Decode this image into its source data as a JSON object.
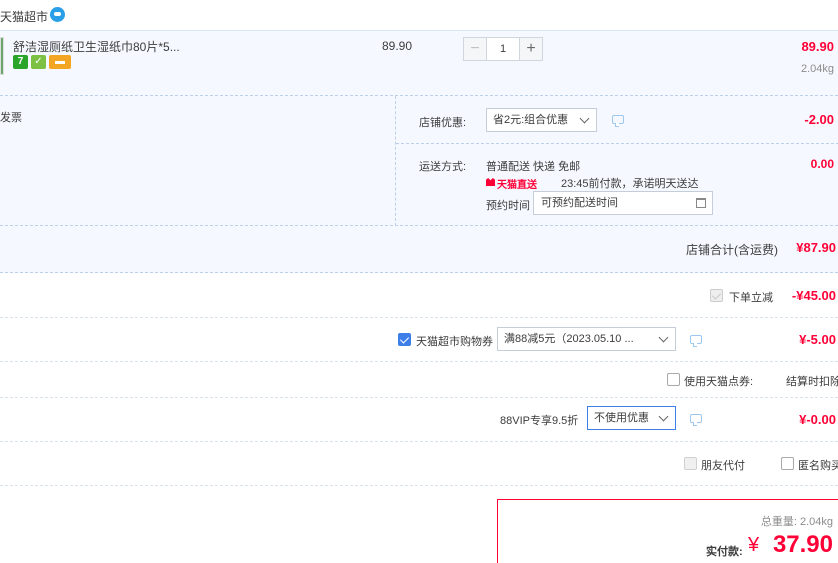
{
  "shop": {
    "name": "天猫超市"
  },
  "item": {
    "title": "舒洁湿厕纸卫生湿纸巾80片*5...",
    "unit_price": "89.90",
    "quantity": "1",
    "subtotal": "89.90",
    "weight": "2.04kg",
    "service_icons": [
      "seven-day-return-icon",
      "guarantee-shield-icon",
      "payment-card-icon"
    ]
  },
  "invoice": {
    "label": "发票"
  },
  "shop_discount": {
    "label": "店铺优惠:",
    "selected": "省2元:组合优惠",
    "amount": "-2.00"
  },
  "shipping": {
    "label": "运送方式:",
    "method": "普通配送 快递 免邮",
    "fee": "0.00",
    "badge": "天猫直送",
    "promise": "23:45前付款，承诺明天送达",
    "appointment_label": "预约时间",
    "appointment_placeholder": "可预约配送时间"
  },
  "store_total": {
    "label": "店铺合计(含运费)",
    "value": "¥87.90"
  },
  "instant_discount": {
    "label": "下单立减",
    "amount": "-¥45.00",
    "checked": true
  },
  "coupon": {
    "label": "天猫超市购物券",
    "selected": "满88减5元（2023.05.10 ...",
    "amount": "¥-5.00",
    "checked": true
  },
  "points": {
    "label": "使用天猫点券:",
    "note": "结算时扣除"
  },
  "vip": {
    "label": "88VIP专享9.5折",
    "selected": "不使用优惠",
    "amount": "¥-0.00"
  },
  "pay_for_me": {
    "friend_label": "朋友代付",
    "anonymous_label": "匿名购买"
  },
  "summary": {
    "weight_label": "总重量:",
    "weight_value": "2.04kg",
    "pay_label": "实付款:",
    "currency": "¥",
    "pay_value": "37.90"
  },
  "colors": {
    "accent_red": "#ff0036",
    "row_bg": "#f5f9ff",
    "checkbox_blue": "#3d7ee8"
  }
}
